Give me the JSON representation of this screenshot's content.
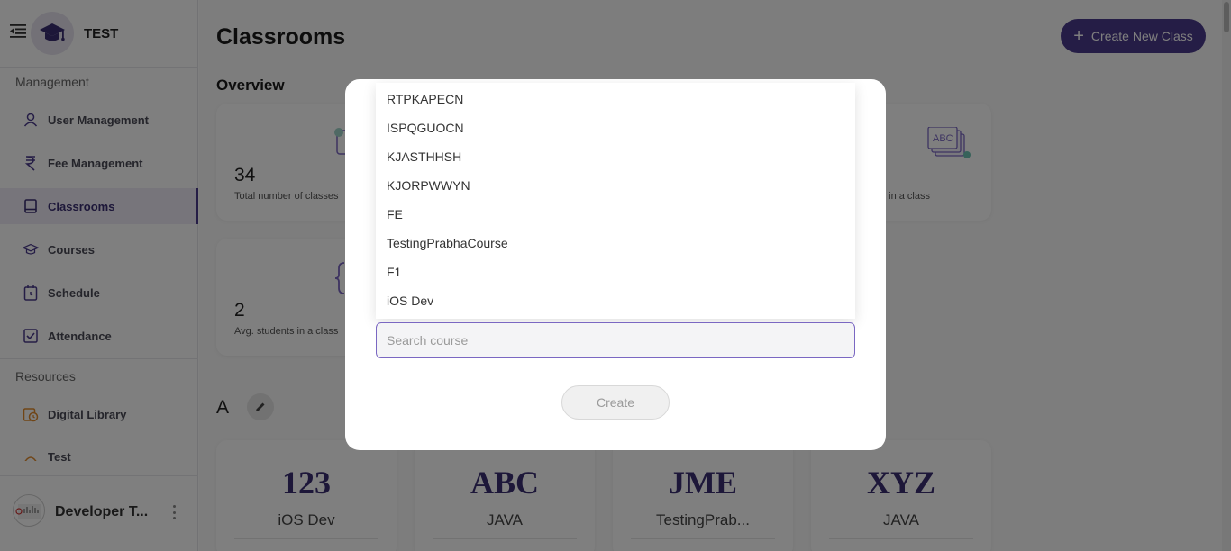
{
  "sidebar": {
    "brand": "TEST",
    "sections": {
      "management": "Management",
      "resources": "Resources"
    },
    "items": [
      {
        "label": "User Management",
        "icon": "user-icon"
      },
      {
        "label": "Fee Management",
        "icon": "rupee-icon"
      },
      {
        "label": "Classrooms",
        "icon": "book-icon",
        "active": true
      },
      {
        "label": "Courses",
        "icon": "graduation-cap-icon"
      },
      {
        "label": "Schedule",
        "icon": "calendar-clock-icon"
      },
      {
        "label": "Attendance",
        "icon": "checkbox-icon"
      },
      {
        "label": "Digital Library",
        "icon": "library-clock-icon"
      },
      {
        "label": "Test",
        "icon": "test-icon"
      }
    ],
    "user": {
      "name": "Developer T..."
    }
  },
  "main": {
    "title": "Classrooms",
    "create_button": "Create New Class",
    "overview_label": "Overview",
    "stats": [
      {
        "value": "34",
        "label": "Total number of classes"
      },
      {
        "value": "2",
        "label": "Avg. students in a class"
      },
      {
        "value": "",
        "label": "s in a class"
      }
    ],
    "group": {
      "letter": "A"
    },
    "classes": [
      {
        "code": "123",
        "course": "iOS Dev"
      },
      {
        "code": "ABC",
        "course": "JAVA"
      },
      {
        "code": "JME",
        "course": "TestingPrab..."
      },
      {
        "code": "XYZ",
        "course": "JAVA"
      }
    ]
  },
  "modal": {
    "course_options": [
      "RTPKAPECN",
      "ISPQGUOCN",
      "KJASTHHSH",
      "KJORPWWYN",
      "FE",
      "TestingPrabhaCourse",
      "F1",
      "iOS Dev"
    ],
    "search_placeholder": "Search course",
    "search_value": "",
    "create_button": "Create"
  },
  "colors": {
    "accent": "#4b3a8c",
    "class_code": "#3b2f73",
    "overlay": "rgba(0,0,0,0.5)"
  }
}
